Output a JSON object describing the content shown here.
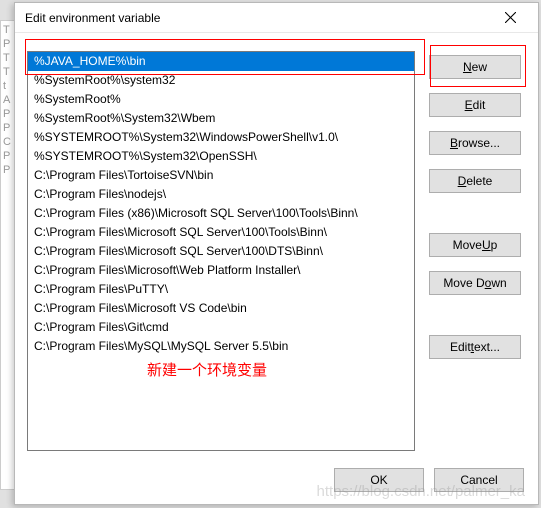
{
  "dialog": {
    "title": "Edit environment variable"
  },
  "list": {
    "items": [
      "%JAVA_HOME%\\bin",
      "%SystemRoot%\\system32",
      "%SystemRoot%",
      "%SystemRoot%\\System32\\Wbem",
      "%SYSTEMROOT%\\System32\\WindowsPowerShell\\v1.0\\",
      "%SYSTEMROOT%\\System32\\OpenSSH\\",
      "C:\\Program Files\\TortoiseSVN\\bin",
      "C:\\Program Files\\nodejs\\",
      "C:\\Program Files (x86)\\Microsoft SQL Server\\100\\Tools\\Binn\\",
      "C:\\Program Files\\Microsoft SQL Server\\100\\Tools\\Binn\\",
      "C:\\Program Files\\Microsoft SQL Server\\100\\DTS\\Binn\\",
      "C:\\Program Files\\Microsoft\\Web Platform Installer\\",
      "C:\\Program Files\\PuTTY\\",
      "C:\\Program Files\\Microsoft VS Code\\bin",
      "C:\\Program Files\\Git\\cmd",
      "C:\\Program Files\\MySQL\\MySQL Server 5.5\\bin"
    ],
    "selected_index": 0
  },
  "buttons": {
    "new_pre": "",
    "new_ul": "N",
    "new_post": "ew",
    "edit_pre": "",
    "edit_ul": "E",
    "edit_post": "dit",
    "browse_pre": "",
    "browse_ul": "B",
    "browse_post": "rowse...",
    "delete_pre": "",
    "delete_ul": "D",
    "delete_post": "elete",
    "moveup_pre": "Move ",
    "moveup_ul": "U",
    "moveup_post": "p",
    "movedown_pre": "Move D",
    "movedown_ul": "o",
    "movedown_post": "wn",
    "edittext_pre": "Edit ",
    "edittext_ul": "t",
    "edittext_post": "ext...",
    "ok": "OK",
    "cancel": "Cancel"
  },
  "annotation": "新建一个环境变量",
  "watermark": "https://blog.csdn.net/palmer_ka",
  "bg_text": "\nT\n\nP\nT\nT\n\n\n\n\n\nt\nA\nP\nP\nC\nP\nP"
}
